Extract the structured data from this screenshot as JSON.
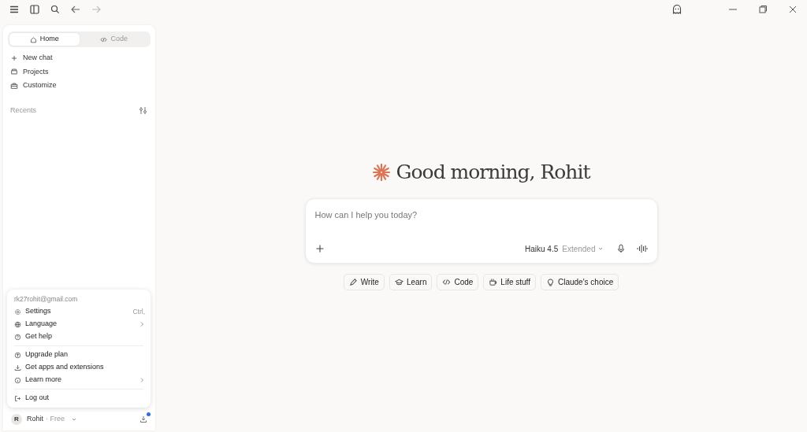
{
  "tabs": [
    {
      "label": "Home",
      "selected": true,
      "kind": "home"
    },
    {
      "label": "Code",
      "selected": false,
      "kind": "code"
    }
  ],
  "nav": [
    {
      "label": "New chat",
      "kind": "plus"
    },
    {
      "label": "Projects",
      "kind": "folder"
    },
    {
      "label": "Customize",
      "kind": "case"
    }
  ],
  "recents": {
    "label": "Recents"
  },
  "account_menu": {
    "email": "rk27rohit@gmail.com",
    "groups": [
      [
        {
          "label": "Settings",
          "kind": "gear",
          "shortcut": "Ctrl,",
          "submenu": false
        },
        {
          "label": "Language",
          "kind": "globe",
          "submenu": true
        },
        {
          "label": "Get help",
          "kind": "help",
          "submenu": false
        }
      ],
      [
        {
          "label": "Upgrade plan",
          "kind": "up",
          "submenu": false
        },
        {
          "label": "Get apps and extensions",
          "kind": "download",
          "submenu": false
        },
        {
          "label": "Learn more",
          "kind": "info",
          "submenu": true
        }
      ],
      [
        {
          "label": "Log out",
          "kind": "logout",
          "submenu": false
        }
      ]
    ]
  },
  "user": {
    "initial": "R",
    "name": "Rohit",
    "plan": "· Free",
    "notification": true
  },
  "greeting": "Good morning, Rohit",
  "prompt": {
    "placeholder": "How can I help you today?",
    "model": "Haiku 4.5",
    "mode": "Extended"
  },
  "chips": [
    {
      "label": "Write",
      "kind": "pen"
    },
    {
      "label": "Learn",
      "kind": "cap"
    },
    {
      "label": "Code",
      "kind": "code"
    },
    {
      "label": "Life stuff",
      "kind": "cup"
    },
    {
      "label": "Claude's choice",
      "kind": "bulb"
    }
  ]
}
